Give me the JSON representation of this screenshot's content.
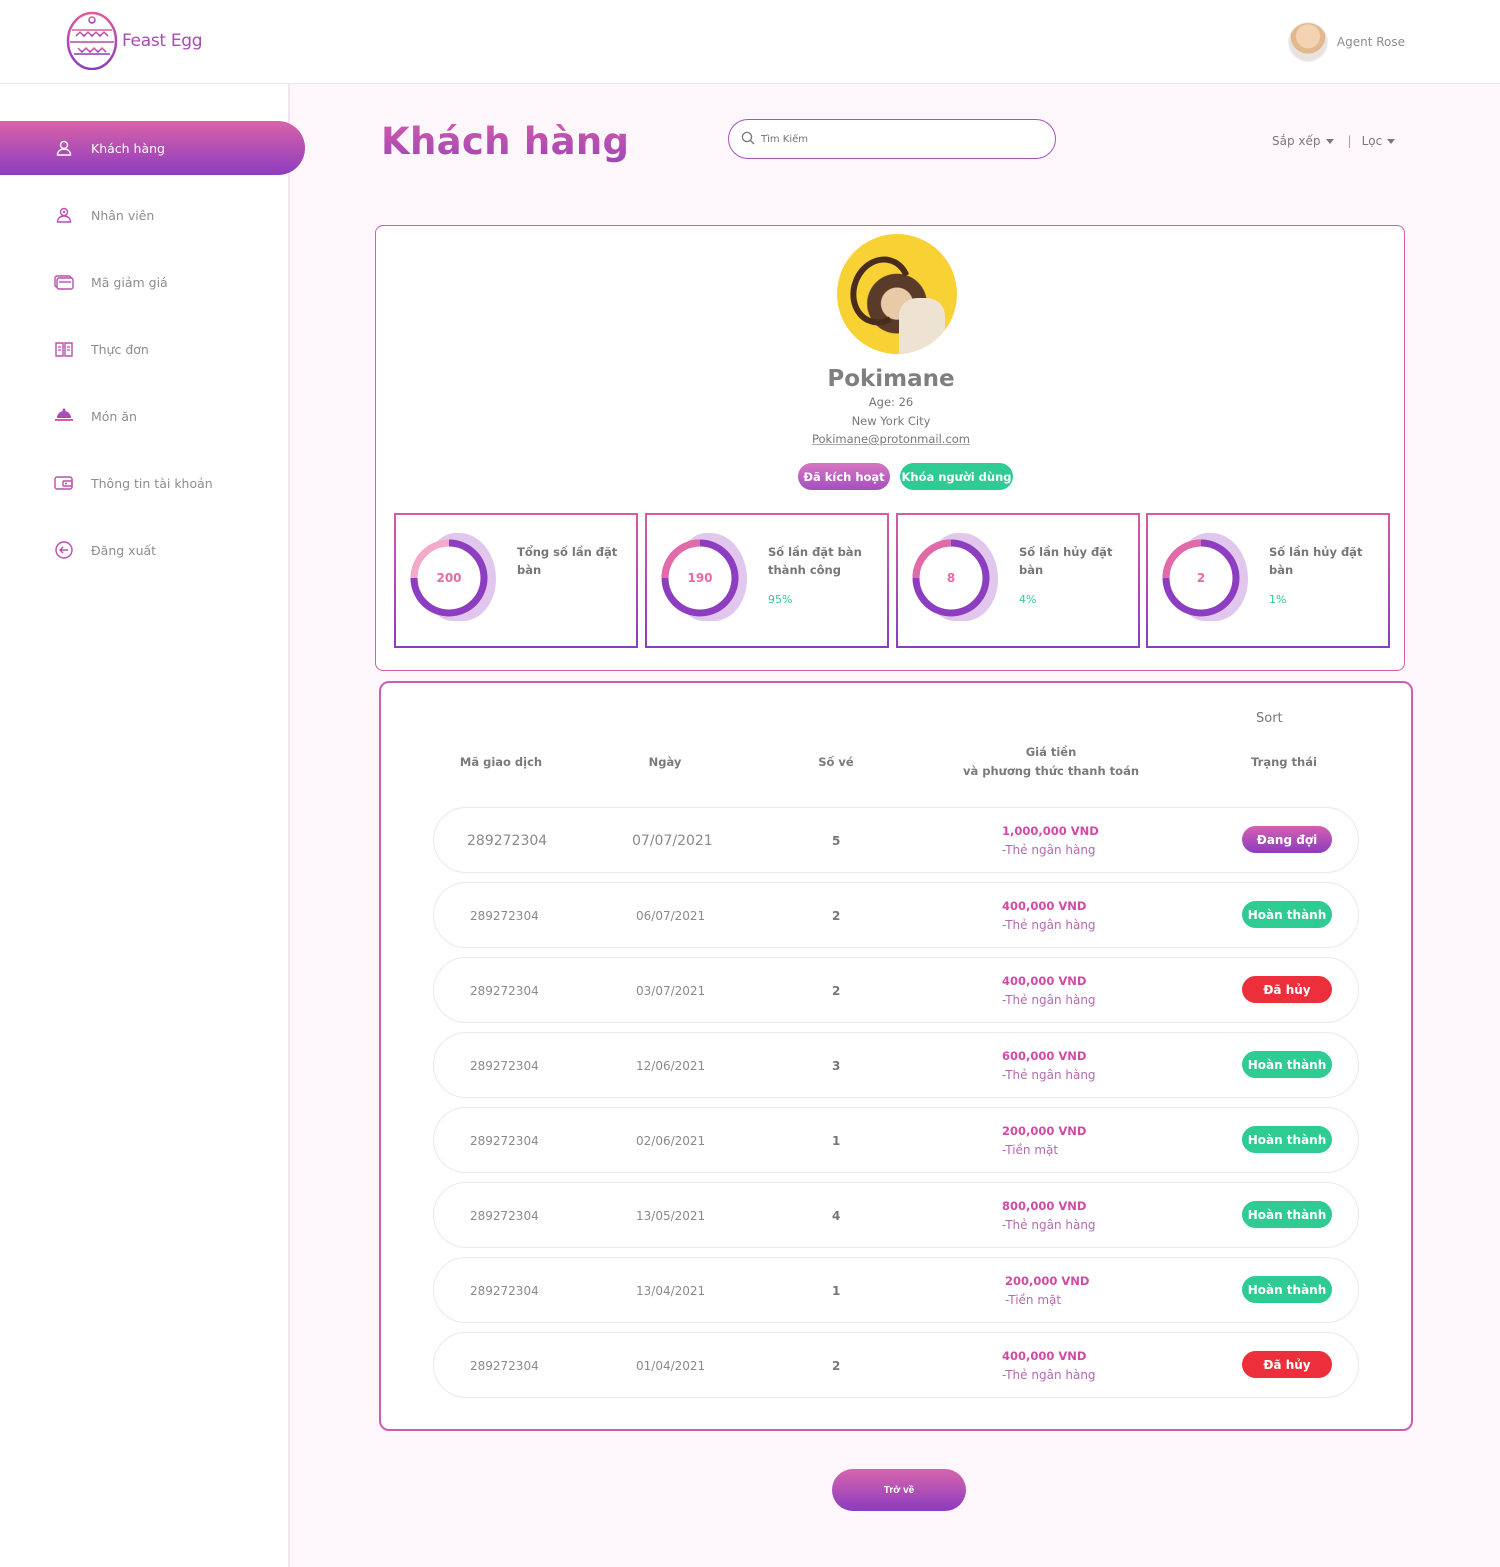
{
  "brand": {
    "name": "Feast Egg"
  },
  "user": {
    "name": "Agent Rose"
  },
  "sidebar": {
    "items": [
      {
        "label": "Khách hàng",
        "icon": "user-icon"
      },
      {
        "label": "Nhân viên",
        "icon": "staff-icon"
      },
      {
        "label": "Mã giảm giá",
        "icon": "coupon-icon"
      },
      {
        "label": "Thực đơn",
        "icon": "menu-book-icon"
      },
      {
        "label": "Món ăn",
        "icon": "dish-icon"
      },
      {
        "label": "Thông tin tài khoản",
        "icon": "wallet-icon"
      },
      {
        "label": "Đăng xuất",
        "icon": "logout-icon"
      }
    ]
  },
  "page": {
    "title": "Khách hàng"
  },
  "search": {
    "placeholder": "Tìm Kiếm"
  },
  "controls": {
    "sort_label": "Sắp xếp",
    "filter_label": "Lọc"
  },
  "profile": {
    "name": "Pokimane",
    "age": "Age: 26",
    "city": "New York City",
    "email": "Pokimane@protonmail.com",
    "badge_active": "Đã kích hoạt",
    "badge_lock": "Khóa người dùng"
  },
  "stats": [
    {
      "value": "200",
      "label": "Tổng số lần đặt bàn",
      "percent": ""
    },
    {
      "value": "190",
      "label": "Số lần đặt bàn thành công",
      "percent": "95%"
    },
    {
      "value": "8",
      "label": "Số lần hủy đặt bàn",
      "percent": "4%"
    },
    {
      "value": "2",
      "label": "Số lần hủy đặt bàn",
      "percent": "1%"
    }
  ],
  "table": {
    "sort_label": "Sort",
    "headers": {
      "id": "Mã giao dịch",
      "date": "Ngày",
      "qty": "Số vé",
      "price_line1": "Giá tiền",
      "price_line2": "và phương thức thanh toán",
      "status": "Trạng thái"
    },
    "rows": [
      {
        "id": "289272304",
        "date": "07/07/2021",
        "qty": "5",
        "amount": "1,000,000 VND",
        "method": "-Thẻ ngân hàng",
        "status": "Đang đợi",
        "status_type": "waiting"
      },
      {
        "id": "289272304",
        "date": "06/07/2021",
        "qty": "2",
        "amount": "400,000 VND",
        "method": "-Thẻ ngân hàng",
        "status": "Hoàn thành",
        "status_type": "done"
      },
      {
        "id": "289272304",
        "date": "03/07/2021",
        "qty": "2",
        "amount": "400,000 VND",
        "method": "-Thẻ ngân hàng",
        "status": "Đã hủy",
        "status_type": "cancel"
      },
      {
        "id": "289272304",
        "date": "12/06/2021",
        "qty": "3",
        "amount": "600,000 VND",
        "method": "-Thẻ ngân hàng",
        "status": "Hoàn thành",
        "status_type": "done"
      },
      {
        "id": "289272304",
        "date": "02/06/2021",
        "qty": "1",
        "amount": "200,000 VND",
        "method": "-Tiền mặt",
        "status": "Hoàn thành",
        "status_type": "done"
      },
      {
        "id": "289272304",
        "date": "13/05/2021",
        "qty": "4",
        "amount": "800,000 VND",
        "method": "-Thẻ ngân hàng",
        "status": "Hoàn thành",
        "status_type": "done"
      },
      {
        "id": "289272304",
        "date": "13/04/2021",
        "qty": "1",
        "amount": "200,000 VND",
        "method": "-Tiền mặt",
        "status": "Hoàn thành",
        "status_type": "done"
      },
      {
        "id": "289272304",
        "date": "01/04/2021",
        "qty": "2",
        "amount": "400,000 VND",
        "method": "-Thẻ ngân hàng",
        "status": "Đã hủy",
        "status_type": "cancel"
      }
    ]
  },
  "back_button": {
    "label": "Trở về"
  },
  "colors": {
    "accent_pink": "#d863a8",
    "accent_purple": "#8e3cbf",
    "success": "#2ecb93",
    "danger": "#ec2f3a"
  }
}
